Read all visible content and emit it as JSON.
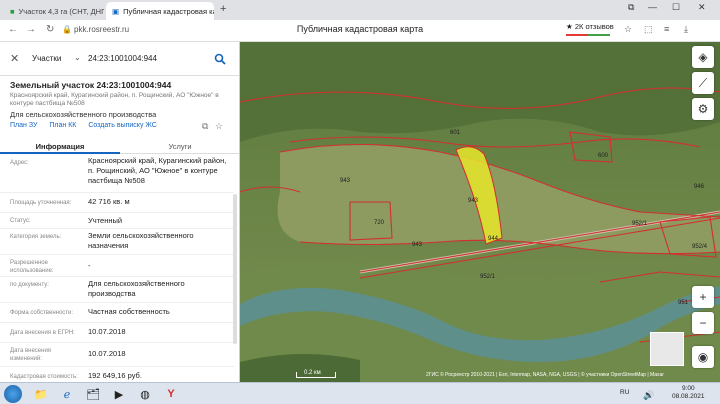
{
  "browser": {
    "tab1_title": "Участок 4,3 га (СНТ, ДНП)",
    "tab2_title": "Публичная кадастровая карта",
    "url": "pkk.rosreestr.ru",
    "page_title": "Публичная кадастровая карта",
    "reviews": "2К отзывов"
  },
  "search": {
    "mode": "Участки",
    "query": "24:23:1001004:944"
  },
  "object": {
    "title": "Земельный участок 24:23:1001004:944",
    "address": "Красноярский край, Курагинский район, п. Рощинский, АО \"Южное\" в контуре пастбища №508",
    "use": "Для сельскохозяйственного производства",
    "links": [
      "План ЗУ",
      "План КК",
      "Создать выписку ЖС"
    ]
  },
  "tabs": [
    "Информация",
    "Услуги"
  ],
  "info_rows": [
    {
      "label": "Адрес:",
      "value": "Красноярский край, Курагинский район, п. Рощинский, АО \"Южное\" в контуре пастбища №508"
    },
    {
      "label": "Площадь уточненная:",
      "value": "42 716 кв. м"
    },
    {
      "label": "Статус:",
      "value": "Учтенный"
    },
    {
      "label": "Категория земель:",
      "value": "Земли сельскохозяйственного назначения"
    },
    {
      "label": "Разрешенное использование:",
      "value": "-"
    },
    {
      "label": "по документу:",
      "value": "Для сельскохозяйственного производства"
    },
    {
      "label": "Форма собственности:",
      "value": "Частная собственность"
    },
    {
      "label": "Дата внесения в ЕГРН:",
      "value": "10.07.2018"
    },
    {
      "label": "Дата внесения изменений:",
      "value": "10.07.2018"
    },
    {
      "label": "Кадастровая стоимость:",
      "value": "192 649,16 руб."
    }
  ],
  "map": {
    "parcel_labels": [
      "601",
      "600",
      "943",
      "943",
      "720",
      "943",
      "944",
      "946",
      "952/1",
      "952/1",
      "952/4",
      "951"
    ],
    "scale": "0.2 км",
    "attribution": "2ГИС © Росреестр 2010-2021 | Esri, Intermap, NASA, NGA, USGS | © участники OpenStreetMap | Maxar",
    "accent_color": "#1565c0",
    "parcel_border_color": "#d32f2f",
    "selected_fill_color": "#e6e62a"
  },
  "taskbar": {
    "lang": "RU",
    "time": "9:00",
    "date": "08.08.2021"
  }
}
